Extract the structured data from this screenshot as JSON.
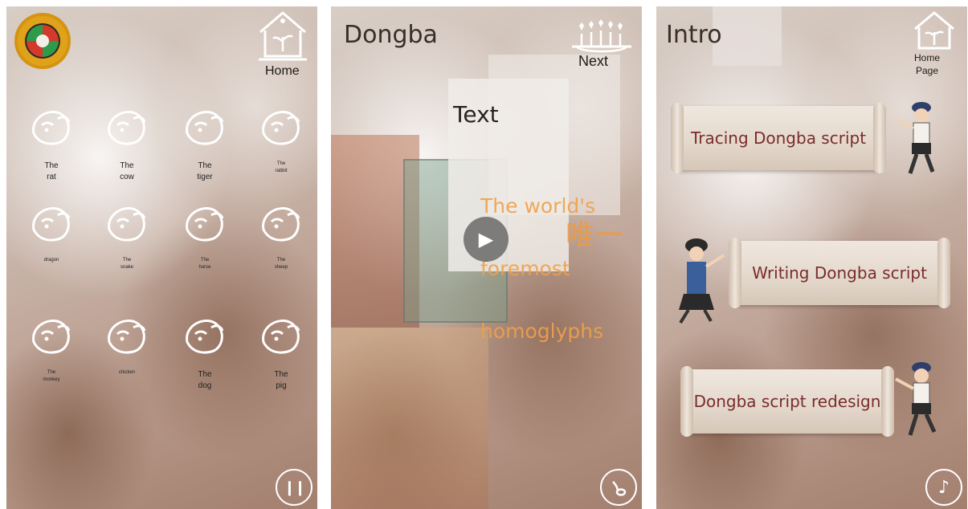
{
  "panel1": {
    "home_label": "Home",
    "zodiac": [
      {
        "label": "The\nrat",
        "small": false
      },
      {
        "label": "The\ncow",
        "small": false
      },
      {
        "label": "The\ntiger",
        "small": false
      },
      {
        "label": "The\nrabbit",
        "small": true
      },
      {
        "label": "dragon",
        "small": true
      },
      {
        "label": "The\nsnake",
        "small": true
      },
      {
        "label": "The\nhorse",
        "small": true
      },
      {
        "label": "The\nsheep",
        "small": true
      },
      {
        "label": "The\nmonkey",
        "small": true
      },
      {
        "label": "chicken",
        "small": true
      },
      {
        "label": "The\ndog",
        "small": false
      },
      {
        "label": "The\npig",
        "small": false
      }
    ],
    "pause_icon": "pause-icon"
  },
  "panel2": {
    "title": "Dongba",
    "next_label": "Next",
    "text_label": "Text",
    "orange_line1": "The world's",
    "orange_line2": "foremost",
    "orange_line3": "homoglyphs",
    "cjk_text": "唯一",
    "play_icon": "play-icon",
    "note_icon": "music-note-icon"
  },
  "panel3": {
    "title": "Intro",
    "home_label": "Home\nPage",
    "menu": [
      {
        "label": "Tracing Dongba script"
      },
      {
        "label": "Writing Dongba script"
      },
      {
        "label": "Dongba script redesign"
      }
    ],
    "music_icon": "music-note-icon"
  }
}
